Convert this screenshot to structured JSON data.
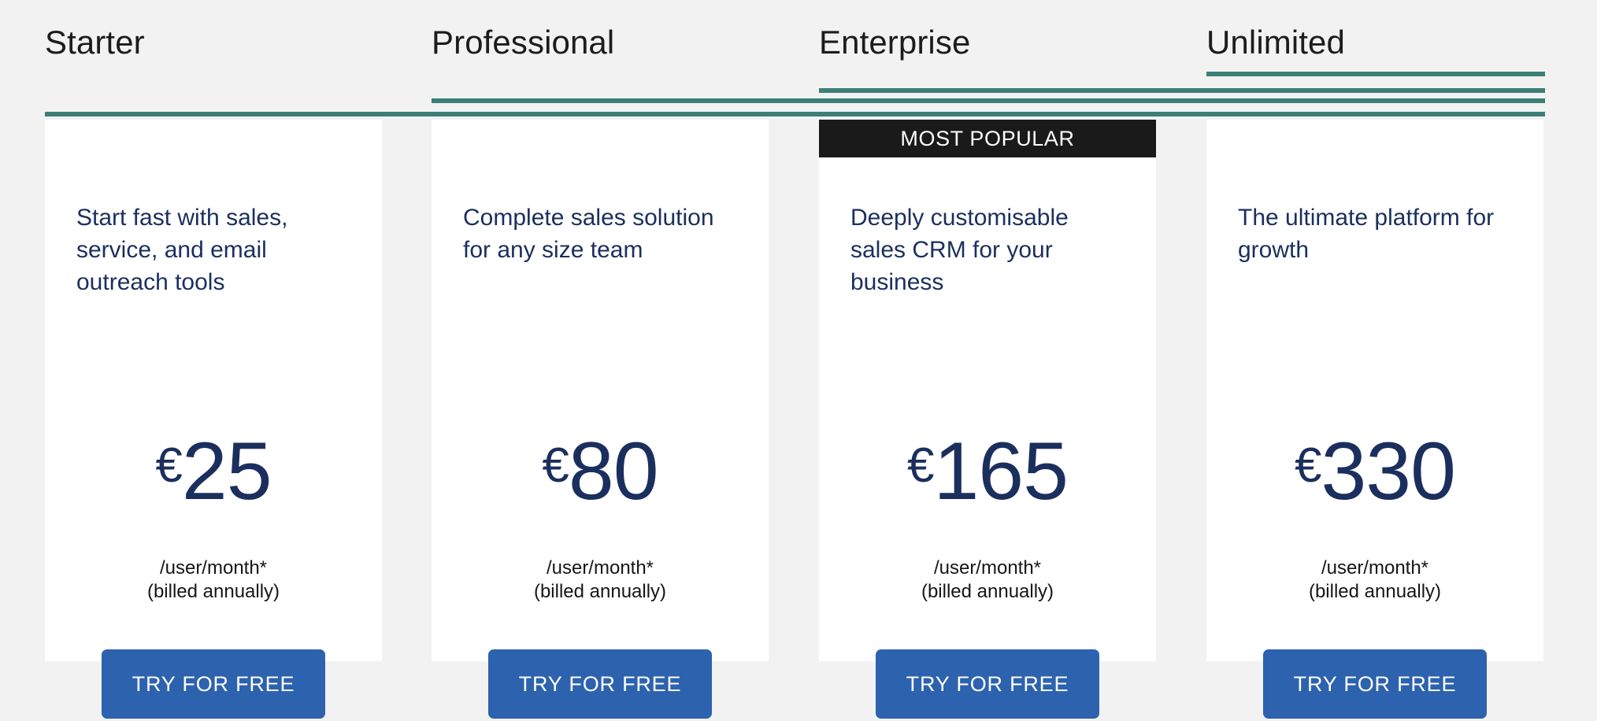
{
  "theme": {
    "page_background": "#F2F2F2",
    "card_background": "#FFFFFF",
    "accent_teal": "#3C7F77",
    "navy_text": "#1B2F5E",
    "button_blue": "#2D62AE",
    "banner_black": "#1A1A1A",
    "tab_text": "#1C1C1C"
  },
  "tabs": [
    {
      "label": "Starter"
    },
    {
      "label": "Professional"
    },
    {
      "label": "Enterprise"
    },
    {
      "label": "Unlimited"
    }
  ],
  "plans": [
    {
      "name": "Starter",
      "description": "Start fast with sales, service, and email outreach tools",
      "currency": "€",
      "price": "25",
      "per_unit": "/user/month*",
      "billing_note": "(billed annually)",
      "cta_label": "TRY FOR FREE",
      "badge": null
    },
    {
      "name": "Professional",
      "description": "Complete sales solution for any size team",
      "currency": "€",
      "price": "80",
      "per_unit": "/user/month*",
      "billing_note": "(billed annually)",
      "cta_label": "TRY FOR FREE",
      "badge": null
    },
    {
      "name": "Enterprise",
      "description": "Deeply customisable sales CRM for your business",
      "currency": "€",
      "price": "165",
      "per_unit": "/user/month*",
      "billing_note": "(billed annually)",
      "cta_label": "TRY FOR FREE",
      "badge": "MOST POPULAR"
    },
    {
      "name": "Unlimited",
      "description": "The ultimate platform for growth",
      "currency": "€",
      "price": "330",
      "per_unit": "/user/month*",
      "billing_note": "(billed annually)",
      "cta_label": "TRY FOR FREE",
      "badge": null
    }
  ]
}
